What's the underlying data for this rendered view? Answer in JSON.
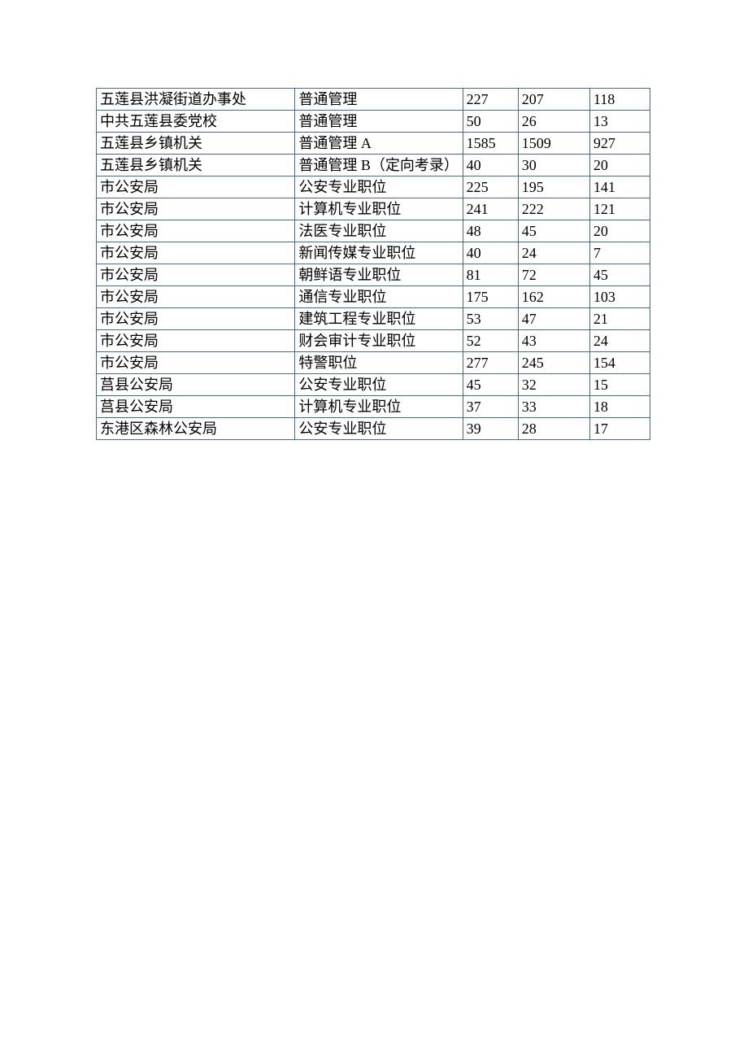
{
  "rows": [
    {
      "org": "五莲县洪凝街道办事处",
      "pos": "普通管理",
      "n1": "227",
      "n2": "207",
      "n3": "118"
    },
    {
      "org": "中共五莲县委党校",
      "pos": "普通管理",
      "n1": "50",
      "n2": "26",
      "n3": "13"
    },
    {
      "org": "五莲县乡镇机关",
      "pos": "普通管理 A",
      "n1": "1585",
      "n2": "1509",
      "n3": "927"
    },
    {
      "org": "五莲县乡镇机关",
      "pos": "普通管理 B（定向考录）",
      "n1": "40",
      "n2": "30",
      "n3": "20"
    },
    {
      "org": "市公安局",
      "pos": "公安专业职位",
      "n1": "225",
      "n2": "195",
      "n3": "141"
    },
    {
      "org": "市公安局",
      "pos": "计算机专业职位",
      "n1": "241",
      "n2": "222",
      "n3": "121"
    },
    {
      "org": "市公安局",
      "pos": "法医专业职位",
      "n1": "48",
      "n2": "45",
      "n3": "20"
    },
    {
      "org": "市公安局",
      "pos": "新闻传媒专业职位",
      "n1": "40",
      "n2": "24",
      "n3": "7"
    },
    {
      "org": "市公安局",
      "pos": "朝鲜语专业职位",
      "n1": "81",
      "n2": "72",
      "n3": "45"
    },
    {
      "org": "市公安局",
      "pos": "通信专业职位",
      "n1": "175",
      "n2": "162",
      "n3": "103"
    },
    {
      "org": "市公安局",
      "pos": "建筑工程专业职位",
      "n1": "53",
      "n2": "47",
      "n3": "21"
    },
    {
      "org": "市公安局",
      "pos": "财会审计专业职位",
      "n1": "52",
      "n2": "43",
      "n3": "24"
    },
    {
      "org": "市公安局",
      "pos": "特警职位",
      "n1": "277",
      "n2": "245",
      "n3": "154"
    },
    {
      "org": "莒县公安局",
      "pos": "公安专业职位",
      "n1": "45",
      "n2": "32",
      "n3": "15"
    },
    {
      "org": "莒县公安局",
      "pos": "计算机专业职位",
      "n1": "37",
      "n2": "33",
      "n3": "18"
    },
    {
      "org": "东港区森林公安局",
      "pos": "公安专业职位",
      "n1": "39",
      "n2": "28",
      "n3": "17"
    }
  ]
}
